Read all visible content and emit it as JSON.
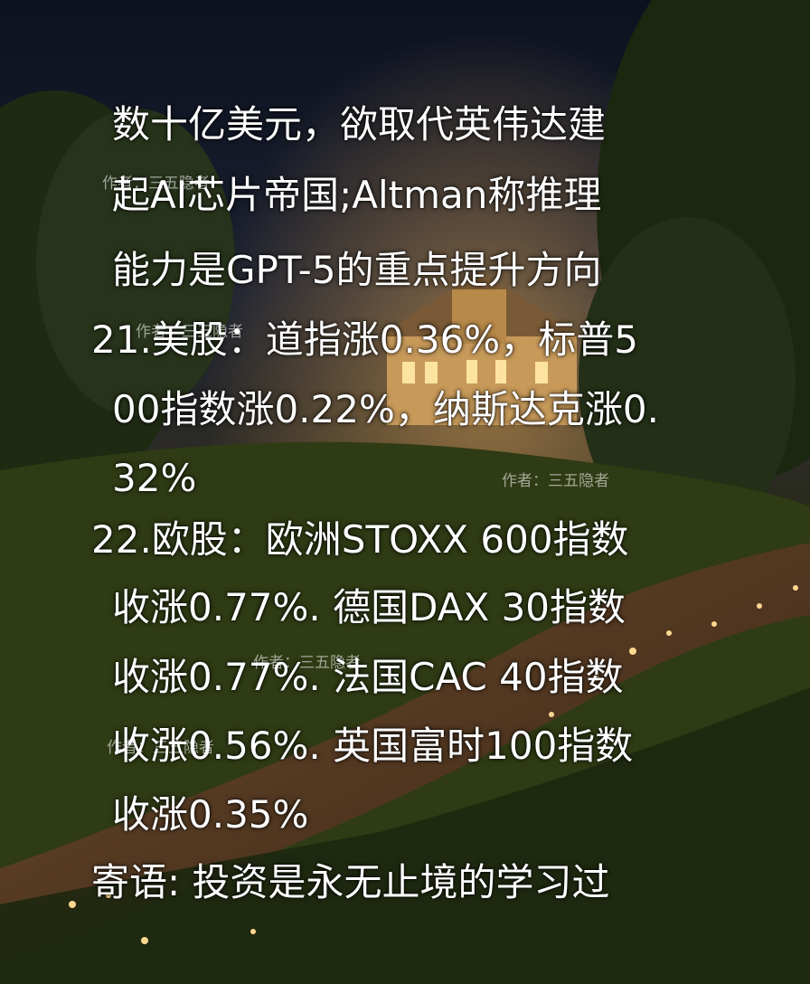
{
  "lines": [
    "数十亿美元，欲取代英伟达建",
    "起AI芯片帝国;Altman称推理",
    "能力是GPT-5的重点提升方向",
    "21.美股：道指涨0.36%，标普5",
    "00指数涨0.22%，纳斯达克涨0.",
    "32%",
    "22.欧股：欧洲STOXX 600指数",
    "收涨0.77%. 德国DAX 30指数",
    "收涨0.77%. 法国CAC 40指数",
    "收涨0.56%. 英国富时100指数",
    "收涨0.35%",
    "寄语: 投资是永无止境的学习过"
  ],
  "watermark": "作者：三五隐者"
}
